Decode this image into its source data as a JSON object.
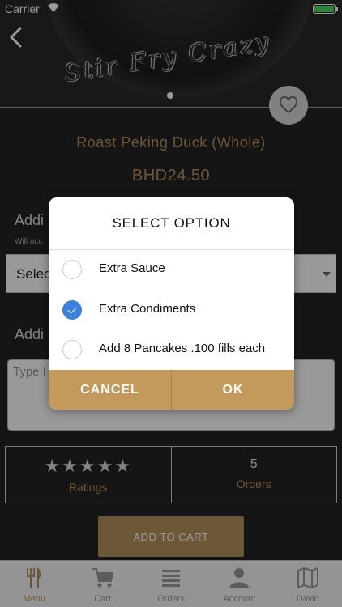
{
  "status_bar": {
    "carrier": "Carrier",
    "time": ""
  },
  "hero": {
    "logo_text": "Stir Fry Crazy",
    "back_icon": "chevron-left-icon",
    "favorite_icon": "heart-icon"
  },
  "product": {
    "name": "Roast Peking Duck (Whole)",
    "price": "BHD24.50"
  },
  "addons": {
    "heading": "Addi",
    "subtext": "Will acc",
    "select_label": "Selec"
  },
  "instructions": {
    "heading": "Addi",
    "placeholder": "Type I"
  },
  "stats": {
    "rating_stars": "★★★★★",
    "rating_value": 5,
    "ratings_label": "Ratings",
    "orders_value": "5",
    "orders_label": "Orders"
  },
  "add_to_cart_label": "ADD TO CART",
  "tabs": [
    {
      "label": "Menu",
      "icon": "fork-knife-icon",
      "active": true
    },
    {
      "label": "Cart",
      "icon": "cart-icon",
      "active": false
    },
    {
      "label": "Orders",
      "icon": "list-icon",
      "active": false
    },
    {
      "label": "Account",
      "icon": "person-icon",
      "active": false
    },
    {
      "label": "David",
      "icon": "map-icon",
      "active": false
    }
  ],
  "dialog": {
    "title": "SELECT OPTION",
    "options": [
      {
        "label": "Extra Sauce",
        "checked": false
      },
      {
        "label": "Extra Condiments",
        "checked": true
      },
      {
        "label": "Add 8 Pancakes .100 fills each",
        "checked": false
      }
    ],
    "cancel_label": "CANCEL",
    "ok_label": "OK"
  },
  "colors": {
    "accent_gold": "#b5915a",
    "background": "#262424",
    "radio_selected": "#3a80e0"
  }
}
